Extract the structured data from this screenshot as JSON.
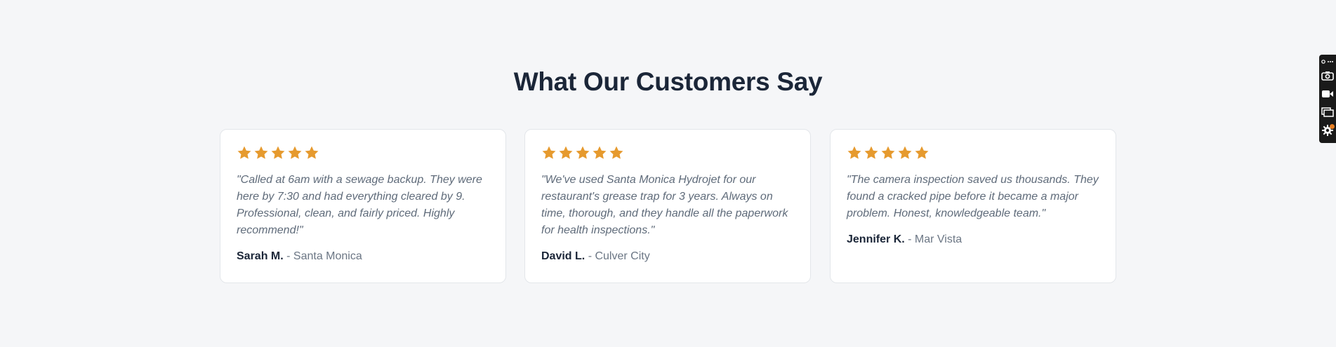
{
  "section": {
    "title": "What Our Customers Say"
  },
  "testimonials": [
    {
      "rating": 5,
      "quote": "\"Called at 6am with a sewage backup. They were here by 7:30 and had everything cleared by 9. Professional, clean, and fairly priced. Highly recommend!\"",
      "name": "Sarah M.",
      "location": "- Santa Monica"
    },
    {
      "rating": 5,
      "quote": "\"We've used Santa Monica Hydrojet for our restaurant's grease trap for 3 years. Always on time, thorough, and they handle all the paperwork for health inspections.\"",
      "name": "David L.",
      "location": "- Culver City"
    },
    {
      "rating": 5,
      "quote": "\"The camera inspection saved us thousands. They found a cracked pipe before it became a major problem. Honest, knowledgeable team.\"",
      "name": "Jennifer K.",
      "location": "- Mar Vista"
    }
  ],
  "colors": {
    "star": "#e69a2e",
    "heading": "#1b2638",
    "background": "#f5f6f8"
  },
  "toolbar": {
    "icons": [
      "link-more-icon",
      "camera-icon",
      "video-icon",
      "windows-icon",
      "gear-icon"
    ]
  }
}
